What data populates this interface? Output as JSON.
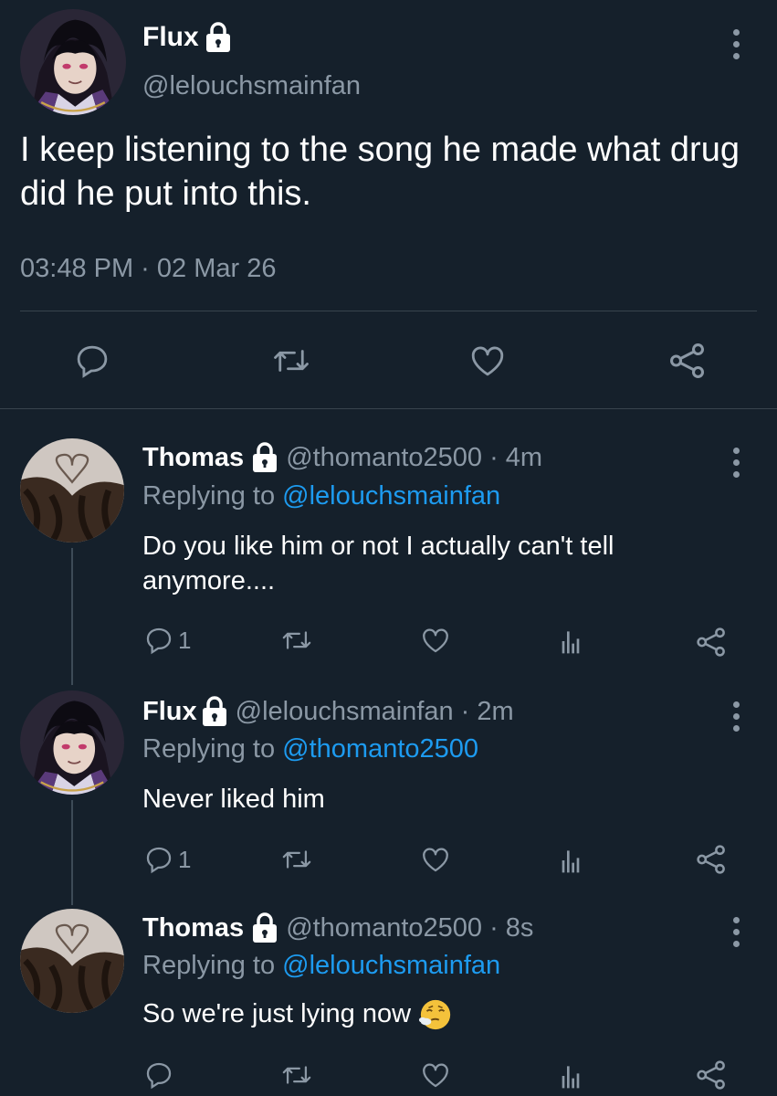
{
  "main_tweet": {
    "name": "Flux",
    "handle": "@lelouchsmainfan",
    "text": "I keep listening to the song he made what drug did he put into this.",
    "timestamp": "03:48 PM · 02 Mar 26",
    "actions": [
      "reply-icon",
      "retweet-icon",
      "like-icon",
      "share-icon"
    ]
  },
  "replies": [
    {
      "name": "Thomas",
      "handle": "@thomanto2500",
      "sep": "·",
      "time": "4m",
      "replying_prefix": "Replying to",
      "replying_to": "@lelouchsmainfan",
      "text": "Do you like him or not I actually can't tell anymore....",
      "reply_count": "1"
    },
    {
      "name": "Flux",
      "handle": "@lelouchsmainfan",
      "sep": "·",
      "time": "2m",
      "replying_prefix": "Replying to",
      "replying_to": "@thomanto2500",
      "text": "Never liked him",
      "reply_count": "1"
    },
    {
      "name": "Thomas",
      "handle": "@thomanto2500",
      "sep": "·",
      "time": "8s",
      "replying_prefix": "Replying to",
      "replying_to": "@lelouchsmainfan",
      "text": "So we're just lying now",
      "emoji": "relieved-exhale-face",
      "reply_count": ""
    }
  ],
  "colors": {
    "background": "#15202b",
    "secondary_text": "#8b98a5",
    "mention": "#1d9bf0",
    "divider": "#38444d"
  }
}
